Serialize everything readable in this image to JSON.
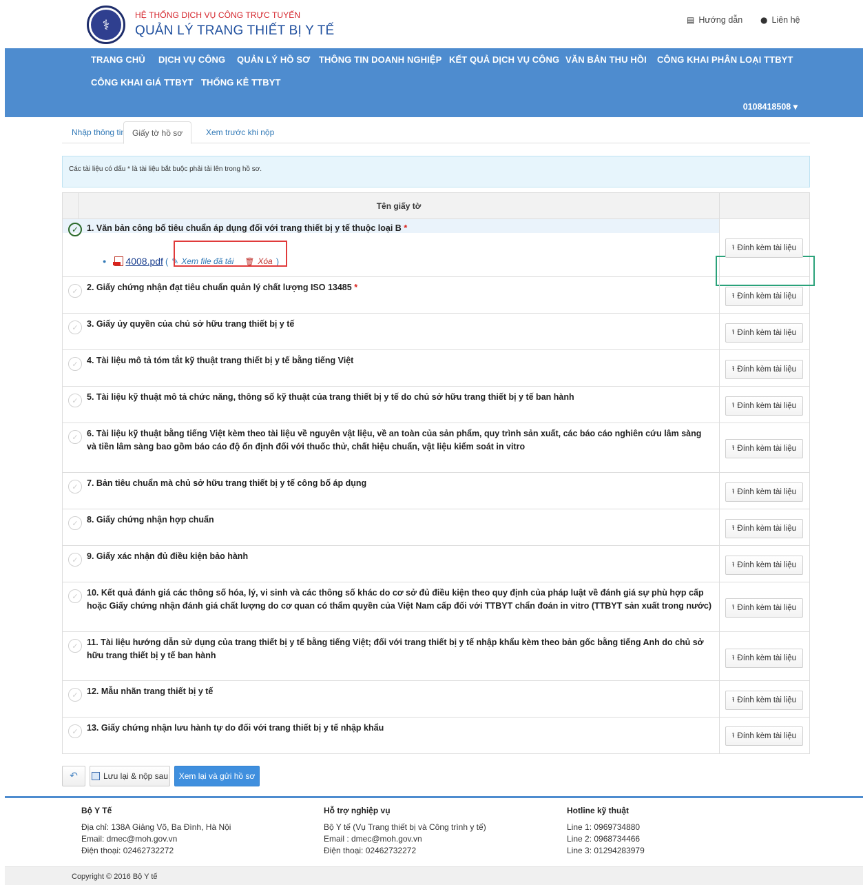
{
  "header": {
    "brand_line1": "HỆ THỐNG DỊCH VỤ CÔNG TRỰC TUYẾN",
    "brand_line2": "QUẢN LÝ TRANG THIẾT BỊ Y TẾ",
    "links": [
      {
        "label": "Hướng dẫn",
        "icon": "book-icon"
      },
      {
        "label": "Liên hệ",
        "icon": "map-marker-icon"
      }
    ]
  },
  "nav": {
    "items": [
      "TRANG CHỦ",
      "DỊCH VỤ CÔNG",
      "QUẢN LÝ HỒ SƠ",
      "THÔNG TIN DOANH NGHIỆP",
      "KẾT QUẢ DỊCH VỤ CÔNG",
      "VĂN BẢN THU HỒI",
      "CÔNG KHAI PHÂN LOẠI TTBYT",
      "CÔNG KHAI GIÁ TTBYT",
      "THỐNG KÊ TTBYT"
    ],
    "user": "0108418508 ▾"
  },
  "tabs": [
    "Nhập thông tin",
    "Giấy tờ hồ sơ",
    "Xem trước khi nộp"
  ],
  "active_tab": "Giấy tờ hồ sơ",
  "notice": "Các tài liệu có dấu * là tài liệu bắt buộc phải tải lên trong hồ sơ.",
  "table": {
    "header": "Tên giấy tờ",
    "attach_label": "Đính kèm tài liệu",
    "rows": [
      {
        "title": "1. Văn bản công bố tiêu chuẩn áp dụng đối với trang thiết bị y tế thuộc loại B",
        "required": "*",
        "uploaded": true
      },
      {
        "title": "2. Giấy chứng nhận đạt tiêu chuẩn quản lý chất lượng ISO 13485",
        "required": "*",
        "uploaded": false
      },
      {
        "title": "3. Giấy ủy quyền của chủ sở hữu trang thiết bị y tế",
        "required": "",
        "uploaded": false
      },
      {
        "title": "4. Tài liệu mô tả tóm tắt kỹ thuật trang thiết bị y tế bằng tiếng Việt",
        "required": "",
        "uploaded": false
      },
      {
        "title": "5. Tài liệu kỹ thuật mô tả chức năng, thông số kỹ thuật của trang thiết bị y tế do chủ sở hữu trang thiết bị y tế ban hành",
        "required": "",
        "uploaded": false
      },
      {
        "title": "6. Tài liệu kỹ thuật bằng tiếng Việt kèm theo tài liệu về nguyên vật liệu, về an toàn của sản phẩm, quy trình sản xuất, các báo cáo nghiên cứu lâm sàng và tiền lâm sàng bao gồm báo cáo độ ổn định đối với thuốc thử, chất hiệu chuẩn, vật liệu kiểm soát in vitro",
        "required": "",
        "uploaded": false
      },
      {
        "title": "7. Bản tiêu chuẩn mà chủ sở hữu trang thiết bị y tế công bố áp dụng",
        "required": "",
        "uploaded": false
      },
      {
        "title": "8. Giấy chứng nhận hợp chuẩn",
        "required": "",
        "uploaded": false
      },
      {
        "title": "9. Giấy xác nhận đủ điều kiện bảo hành",
        "required": "",
        "uploaded": false
      },
      {
        "title": "10. Kết quả đánh giá các thông số hóa, lý, vi sinh và các thông số khác do cơ sở đủ điều kiện theo quy định của pháp luật về đánh giá sự phù hợp cấp hoặc Giấy chứng nhận đánh giá chất lượng do cơ quan có thẩm quyền của Việt Nam cấp đối với TTBYT chẩn đoán in vitro (TTBYT sản xuất trong nước)",
        "required": "",
        "uploaded": false
      },
      {
        "title": "11. Tài liệu hướng dẫn sử dụng của trang thiết bị y tế bằng tiếng Việt; đối với trang thiết bị y tế nhập khẩu kèm theo bản gốc bằng tiếng Anh do chủ sở hữu trang thiết bị y tế ban hành",
        "required": "",
        "uploaded": false
      },
      {
        "title": "12. Mẫu nhãn trang thiết bị y tế",
        "required": "",
        "uploaded": false
      },
      {
        "title": "13. Giấy chứng nhận lưu hành tự do đối với trang thiết bị y tế nhập khẩu",
        "required": "",
        "uploaded": false
      }
    ],
    "uploaded_file": {
      "name": "4008.pdf",
      "paren_open": "(",
      "paren_close": ")",
      "view_label": "Xem file đã tải",
      "delete_label": "Xóa"
    }
  },
  "actions": {
    "save_label": "Lưu lại & nộp sau",
    "submit_label": "Xem lại và gửi hồ sơ"
  },
  "footer": {
    "columns": [
      {
        "heading": "Bộ Y Tế",
        "lines": [
          "Địa chỉ: 138A Giảng Võ, Ba Đình, Hà Nội",
          "Email: dmec@moh.gov.vn",
          "Điện thoại: 02462732272"
        ]
      },
      {
        "heading": "Hỗ trợ nghiệp vụ",
        "lines": [
          "Bộ Y tế (Vụ Trang thiết bị và Công trình y tế)",
          "Email : dmec@moh.gov.vn",
          "Điện thoại: 02462732272"
        ]
      },
      {
        "heading": "Hotline kỹ thuật",
        "lines": [
          "Line 1: 0969734880",
          "Line 2: 0968734466",
          "Line 3: 01294283979"
        ]
      }
    ],
    "copyright": "Copyright © 2016 Bộ Y tế"
  },
  "colors": {
    "nav_bg": "#4e8ccf",
    "brand_red": "#d4232a",
    "brand_blue": "#1f4f9e",
    "required_star": "#d9221c",
    "primary_button": "#3f8fde"
  }
}
